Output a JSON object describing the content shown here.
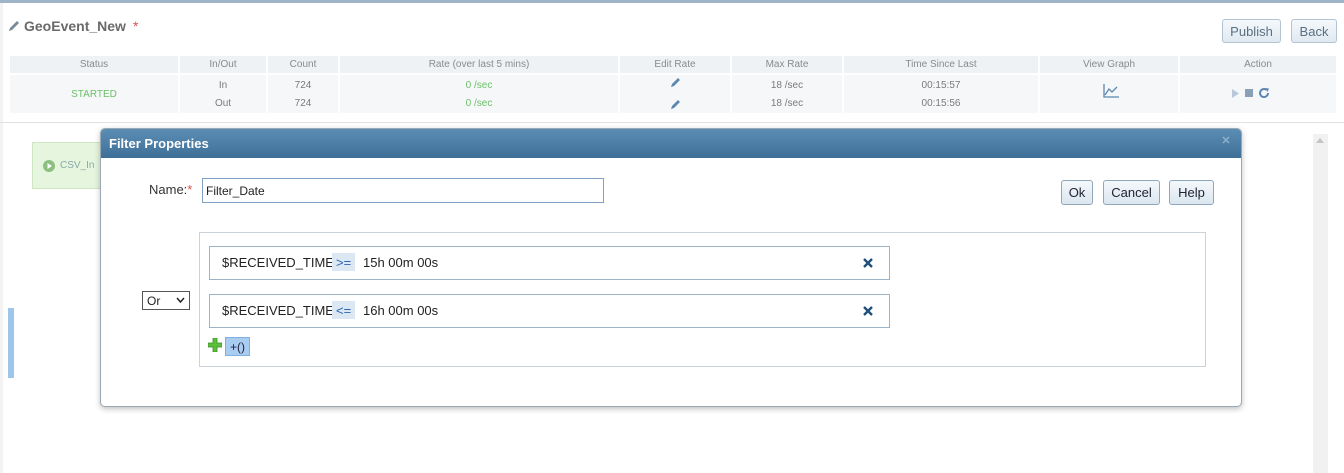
{
  "service": {
    "title": "GeoEvent_New",
    "modified_mark": "*"
  },
  "top_buttons": {
    "publish": "Publish",
    "back": "Back"
  },
  "stats": {
    "headers": [
      "Status",
      "In/Out",
      "Count",
      "Rate (over last 5 mins)",
      "Edit Rate",
      "Max Rate",
      "Time Since Last",
      "View Graph",
      "Action"
    ],
    "status": "STARTED",
    "rows": [
      {
        "io": "In",
        "count": "724",
        "rate": "0 /sec",
        "max_rate": "18 /sec",
        "time_since_last": "00:15:57"
      },
      {
        "io": "Out",
        "count": "724",
        "rate": "0 /sec",
        "max_rate": "18 /sec",
        "time_since_last": "00:15:56"
      }
    ]
  },
  "background_node": {
    "label": "CSV_In"
  },
  "dialog": {
    "title": "Filter Properties",
    "name_label": "Name:",
    "required_mark": "*",
    "name_value": "Filter_Date",
    "buttons": {
      "ok": "Ok",
      "cancel": "Cancel",
      "help": "Help"
    },
    "logic_operator": "Or",
    "conditions": [
      {
        "field": "$RECEIVED_TIME",
        "operator": ">=",
        "value": "15h 00m 00s"
      },
      {
        "field": "$RECEIVED_TIME",
        "operator": "<=",
        "value": "16h 00m 00s"
      }
    ],
    "add_group_label": "+()"
  },
  "colors": {
    "accent": "#3e6f98",
    "status_green": "#6cbf6a",
    "required": "#d9534f"
  }
}
